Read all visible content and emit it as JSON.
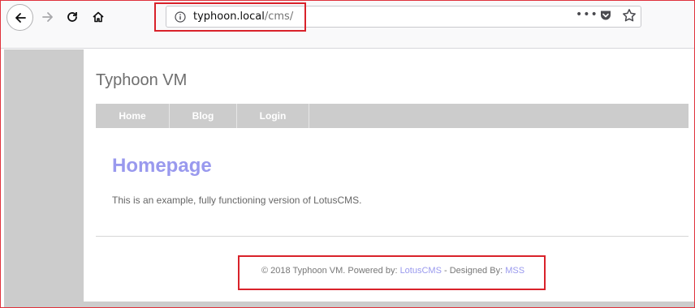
{
  "browser": {
    "url_host": "typhoon.local",
    "url_path": "/cms/",
    "page_actions_label": "•••"
  },
  "site": {
    "title": "Typhoon VM",
    "nav": [
      {
        "label": "Home"
      },
      {
        "label": "Blog"
      },
      {
        "label": "Login"
      }
    ],
    "heading": "Homepage",
    "body_text": "This is an example, fully functioning version of LotusCMS.",
    "footer": {
      "prefix": "© 2018 Typhoon VM. Powered by: ",
      "powered_link": "LotusCMS",
      "middle": " - Designed By: ",
      "designer_link": "MSS"
    }
  },
  "colors": {
    "annotation_red": "#d9222a",
    "link": "#9999ee",
    "nav_bg": "#cccccc"
  },
  "icons": [
    "back-arrow-icon",
    "forward-arrow-icon",
    "reload-icon",
    "home-icon",
    "info-icon",
    "pocket-icon",
    "star-icon"
  ]
}
